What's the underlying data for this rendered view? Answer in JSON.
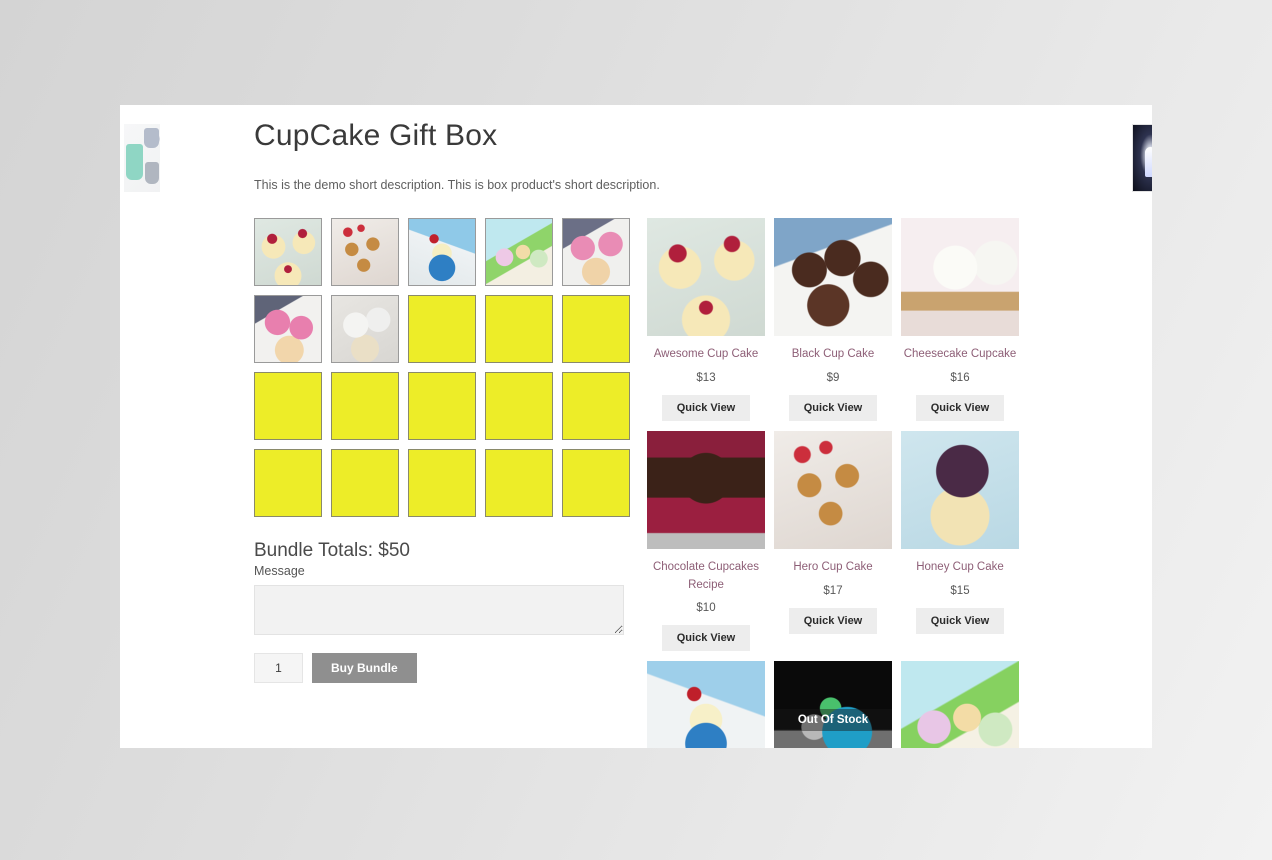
{
  "page": {
    "title": "CupCake Gift Box",
    "short_description": "This is the demo short description. This is box product's short description."
  },
  "bundle": {
    "totals_label": "Bundle Totals: $50",
    "message_label": "Message",
    "message_value": "",
    "message_placeholder": "",
    "quantity_value": "1",
    "buy_button_label": "Buy Bundle",
    "slots": [
      {
        "filled": true,
        "image": "ph-awesome"
      },
      {
        "filled": true,
        "image": "ph-hero"
      },
      {
        "filled": true,
        "image": "ph-cherry"
      },
      {
        "filled": true,
        "image": "ph-unicorn"
      },
      {
        "filled": true,
        "image": "ph-pink"
      },
      {
        "filled": true,
        "image": "ph-pink2"
      },
      {
        "filled": true,
        "image": "ph-white"
      },
      {
        "filled": false,
        "image": ""
      },
      {
        "filled": false,
        "image": ""
      },
      {
        "filled": false,
        "image": ""
      },
      {
        "filled": false,
        "image": ""
      },
      {
        "filled": false,
        "image": ""
      },
      {
        "filled": false,
        "image": ""
      },
      {
        "filled": false,
        "image": ""
      },
      {
        "filled": false,
        "image": ""
      },
      {
        "filled": false,
        "image": ""
      },
      {
        "filled": false,
        "image": ""
      },
      {
        "filled": false,
        "image": ""
      },
      {
        "filled": false,
        "image": ""
      },
      {
        "filled": false,
        "image": ""
      }
    ]
  },
  "products": {
    "quick_view_label": "Quick View",
    "out_of_stock_label": "Out Of Stock",
    "items": [
      {
        "name": "Awesome Cup Cake",
        "price": "$13",
        "image": "ph-awesome",
        "in_stock": true,
        "has_quick_view": true
      },
      {
        "name": "Black Cup Cake",
        "price": "$9",
        "image": "ph-black",
        "in_stock": true,
        "has_quick_view": true
      },
      {
        "name": "Cheesecake Cupcake",
        "price": "$16",
        "image": "ph-cheesecake",
        "in_stock": true,
        "has_quick_view": true
      },
      {
        "name": "Chocolate Cupcakes Recipe",
        "price": "$10",
        "image": "ph-chocolate",
        "in_stock": true,
        "has_quick_view": true
      },
      {
        "name": "Hero Cup Cake",
        "price": "$17",
        "image": "ph-hero",
        "in_stock": true,
        "has_quick_view": true
      },
      {
        "name": "Honey Cup Cake",
        "price": "$15",
        "image": "ph-honey",
        "in_stock": true,
        "has_quick_view": true
      },
      {
        "name": "",
        "price": "",
        "image": "ph-cherry-big",
        "in_stock": true,
        "has_quick_view": false
      },
      {
        "name": "",
        "price": "",
        "image": "ph-forky",
        "in_stock": false,
        "has_quick_view": false
      },
      {
        "name": "",
        "price": "",
        "image": "ph-unicorn-big",
        "in_stock": true,
        "has_quick_view": false
      }
    ]
  },
  "colors": {
    "empty_slot": "#eded28",
    "product_link": "#8d5e76",
    "buy_button": "#8f8f8f",
    "quick_view_button": "#ededed"
  }
}
